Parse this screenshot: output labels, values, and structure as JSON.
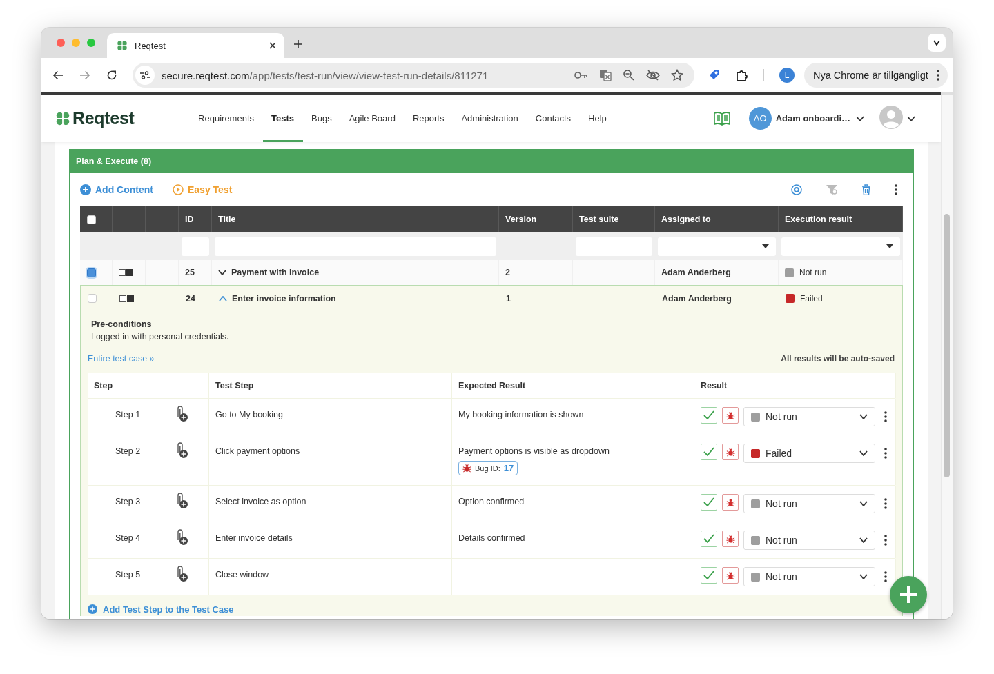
{
  "browser": {
    "tab_title": "Reqtest",
    "url_host": "secure.reqtest.com",
    "url_path": "/app/tests/test-run/view/view-test-run-details/811271",
    "profile_initial": "L",
    "update_label": "Nya Chrome är tillgängligt"
  },
  "app": {
    "logo": "Reqtest",
    "nav": [
      {
        "label": "Requirements",
        "selected": false
      },
      {
        "label": "Tests",
        "selected": true
      },
      {
        "label": "Bugs",
        "selected": false
      },
      {
        "label": "Agile Board",
        "selected": false
      },
      {
        "label": "Reports",
        "selected": false
      },
      {
        "label": "Administration",
        "selected": false
      },
      {
        "label": "Contacts",
        "selected": false
      },
      {
        "label": "Help",
        "selected": false
      }
    ],
    "user_initials": "AO",
    "user_name": "Adam onboardi…"
  },
  "panel": {
    "title": "Plan & Execute (8)",
    "actions": [
      {
        "label": "Add Content",
        "kind": "add"
      },
      {
        "label": "Easy Test",
        "kind": "play"
      }
    ]
  },
  "table": {
    "select_all": {
      "checked": false
    },
    "columns": [
      "ID",
      "Title",
      "Version",
      "Test suite",
      "Assigned to",
      "Execution result"
    ],
    "rows": [
      {
        "checked": true,
        "expanded": false,
        "id": "25",
        "title": "Payment with invoice",
        "version": "2",
        "assigned_to": "Adam Anderberg",
        "result": "Not run",
        "color": "#9e9e9e"
      },
      {
        "checked": false,
        "expanded": true,
        "id": "24",
        "title": "Enter invoice information",
        "version": "1",
        "assigned_to": "Adam Anderberg",
        "result": "Failed",
        "color": "#c62828"
      }
    ]
  },
  "details": {
    "heading": "Pre-conditions",
    "text": "Logged in with personal credentials.",
    "link": "Entire test case »",
    "autosave": "All results will be auto-saved",
    "columns": [
      "Step",
      "Test Step",
      "Expected Result",
      "Result"
    ],
    "steps": [
      {
        "step": "Step 1",
        "action": "Go to My booking",
        "expected": "My booking information is shown",
        "result": "Not run",
        "color": "#9e9e9e"
      },
      {
        "step": "Step 2",
        "action": "Click payment options",
        "expected": "Payment options is visible as dropdown",
        "bug": {
          "label": "Bug ID:",
          "id": "17"
        },
        "result": "Failed",
        "color": "#c62828"
      },
      {
        "step": "Step 3",
        "action": "Select invoice as option",
        "expected": "Option confirmed",
        "result": "Not run",
        "color": "#9e9e9e"
      },
      {
        "step": "Step 4",
        "action": "Enter invoice details",
        "expected": "Details confirmed",
        "result": "Not run",
        "color": "#9e9e9e"
      },
      {
        "step": "Step 5",
        "action": "Close window",
        "result": "Not run",
        "color": "#9e9e9e"
      }
    ],
    "add_step": "Add Test Step to the Test Case"
  }
}
